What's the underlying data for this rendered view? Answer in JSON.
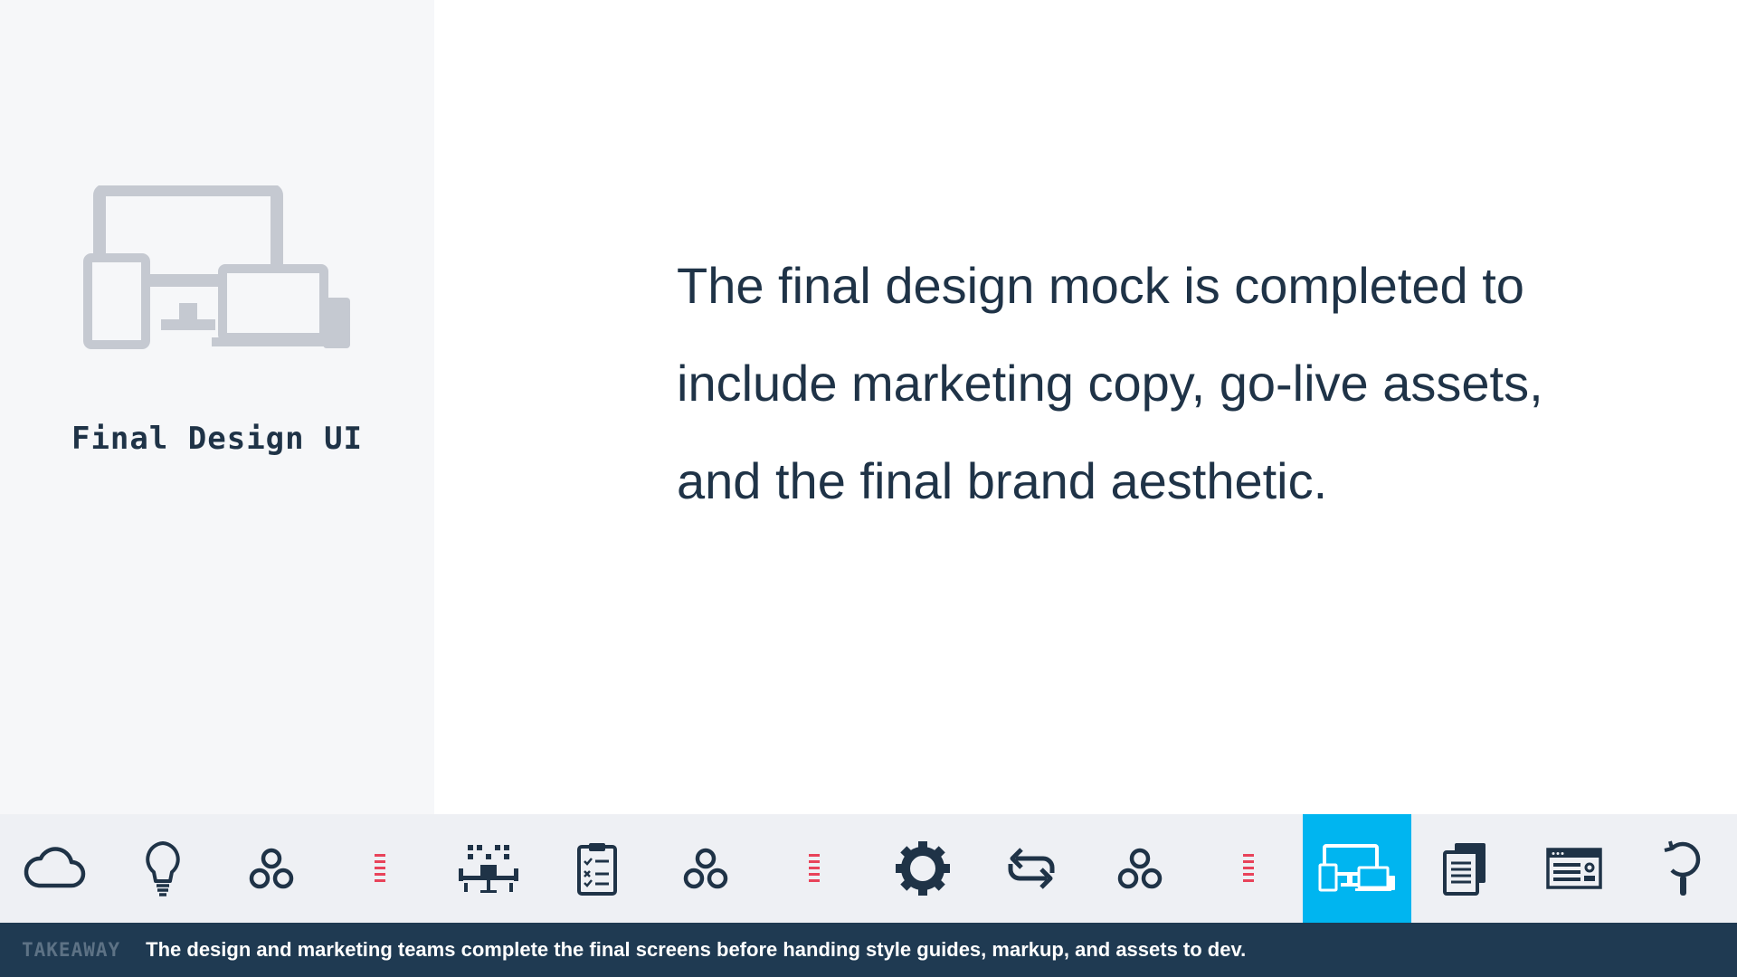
{
  "left_panel": {
    "hero_icon": "devices-icon",
    "title": "Final Design UI"
  },
  "main": {
    "lines": [
      "The final design mock is completed to",
      "include marketing copy, go-live assets,",
      "and the final brand aesthetic."
    ]
  },
  "toolbar": {
    "items": [
      {
        "icon": "cloud-icon"
      },
      {
        "icon": "lightbulb-icon"
      },
      {
        "icon": "three-circles-icon"
      },
      {
        "icon": "separator-dots-icon"
      },
      {
        "icon": "team-meeting-icon"
      },
      {
        "icon": "clipboard-checklist-icon"
      },
      {
        "icon": "three-circles-icon"
      },
      {
        "icon": "separator-dots-icon"
      },
      {
        "icon": "gear-icon"
      },
      {
        "icon": "repeat-icon"
      },
      {
        "icon": "three-circles-icon"
      },
      {
        "icon": "separator-dots-icon"
      },
      {
        "icon": "devices-icon",
        "active": true
      },
      {
        "icon": "documents-icon"
      },
      {
        "icon": "browser-window-icon"
      },
      {
        "icon": "magnifier-icon"
      }
    ]
  },
  "takeaway": {
    "label": "TAKEAWAY",
    "text": "The design and marketing teams complete the final screens before handing style guides, markup, and assets to dev."
  },
  "colors": {
    "dark": "#1f3347",
    "accent": "#00b5f0",
    "separator": "#e8435a",
    "hero_icon": "#c5c9d1",
    "takeaway_bg": "#1f3a52"
  }
}
